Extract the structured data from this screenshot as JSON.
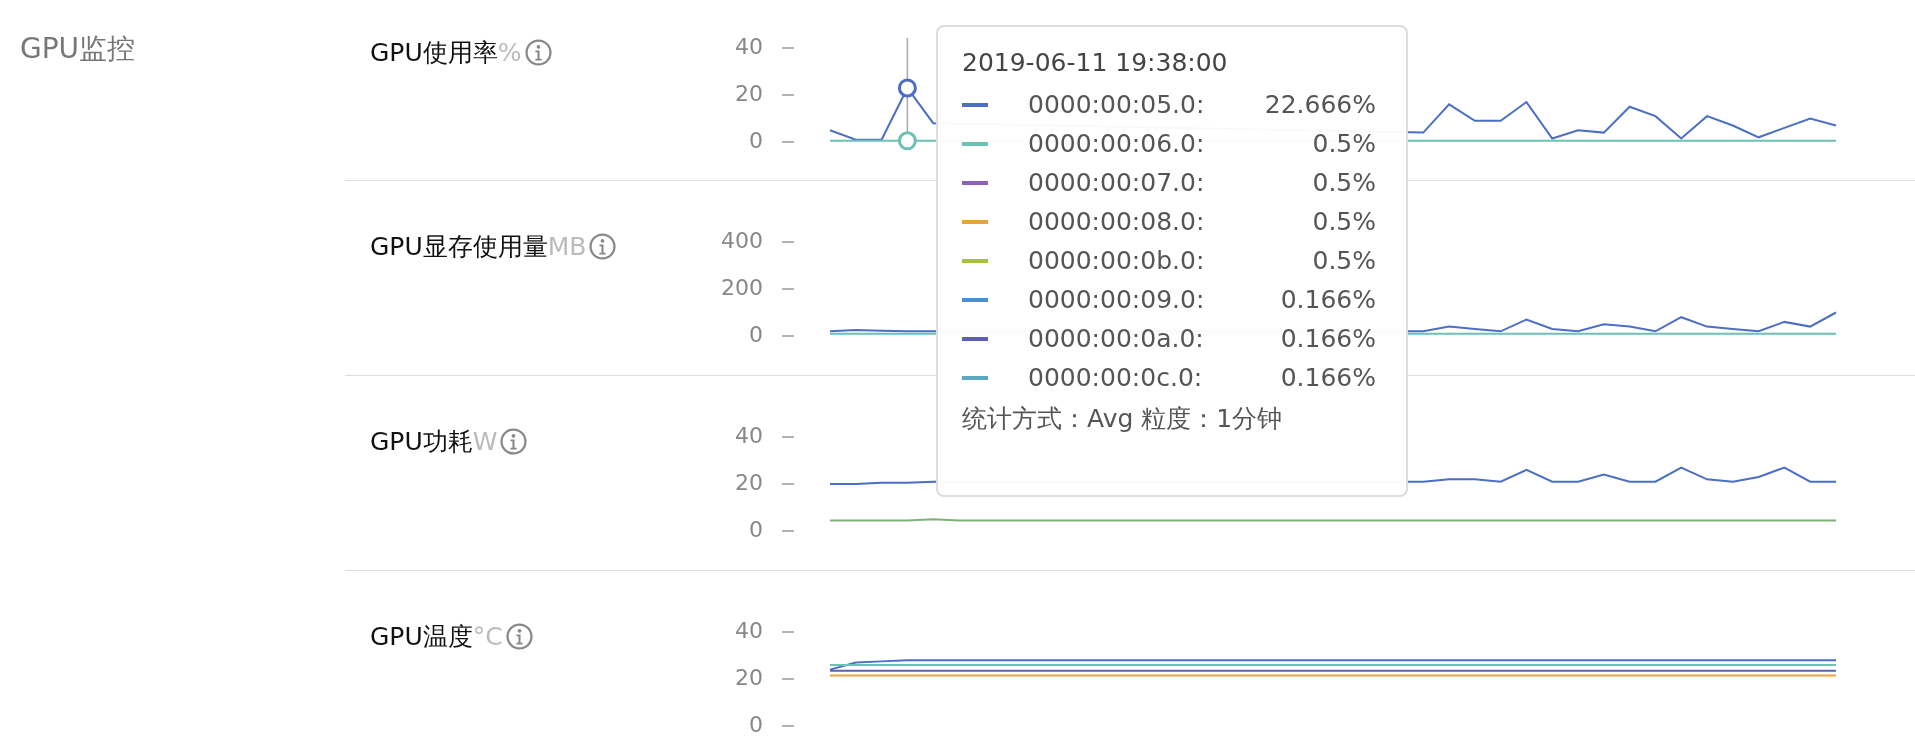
{
  "page_title": "GPU监控",
  "panels": [
    {
      "title": "GPU使用率",
      "unit": "%",
      "chart_data": {
        "type": "line",
        "ylim": [
          0,
          40
        ],
        "yticks": [
          0,
          20,
          40
        ],
        "series": [
          {
            "color": "#4a6fc4",
            "values": [
              5,
              1,
              1,
              23,
              8,
              null,
              null,
              null,
              null,
              null,
              null,
              null,
              null,
              null,
              null,
              null,
              null,
              null,
              null,
              null,
              null,
              null,
              null,
              4,
              16,
              9,
              9,
              17,
              1.5,
              5,
              4,
              15,
              11,
              1.5,
              11,
              7,
              2,
              6,
              10,
              7
            ]
          },
          {
            "color": "#6cc0b4",
            "values": [
              0.5,
              0.5,
              0.5,
              0.5,
              0.5,
              null,
              null,
              null,
              null,
              null,
              null,
              null,
              null,
              null,
              null,
              null,
              null,
              null,
              null,
              null,
              null,
              null,
              null,
              0.5,
              0.5,
              0.5,
              0.5,
              0.5,
              0.5,
              0.5,
              0.5,
              0.5,
              0.5,
              0.5,
              0.5,
              0.5,
              0.5,
              0.5,
              0.5,
              0.5
            ]
          }
        ]
      }
    },
    {
      "title": "GPU显存使用量",
      "unit": "MB",
      "chart_data": {
        "type": "line",
        "ylim": [
          0,
          400
        ],
        "yticks": [
          0,
          200,
          400
        ],
        "series": [
          {
            "color": "#4a6fc4",
            "values": [
              20,
              25,
              22,
              20,
              20,
              null,
              null,
              null,
              null,
              null,
              null,
              null,
              null,
              null,
              null,
              null,
              null,
              null,
              null,
              null,
              null,
              null,
              null,
              20,
              40,
              30,
              20,
              70,
              30,
              20,
              50,
              40,
              20,
              80,
              40,
              30,
              20,
              60,
              40,
              100
            ]
          },
          {
            "color": "#6cc0b4",
            "values": [
              10,
              10,
              10,
              10,
              10,
              null,
              null,
              null,
              null,
              null,
              null,
              null,
              null,
              null,
              null,
              null,
              null,
              null,
              null,
              null,
              null,
              null,
              null,
              10,
              10,
              10,
              10,
              10,
              10,
              10,
              10,
              10,
              10,
              10,
              10,
              10,
              10,
              10,
              10,
              10
            ]
          }
        ]
      }
    },
    {
      "title": "GPU功耗",
      "unit": "W",
      "chart_data": {
        "type": "line",
        "ylim": [
          0,
          40
        ],
        "yticks": [
          0,
          20,
          40
        ],
        "series": [
          {
            "color": "#4a6fc4",
            "values": [
              20,
              20,
              20.5,
              20.5,
              21,
              null,
              null,
              null,
              null,
              null,
              null,
              null,
              null,
              null,
              null,
              null,
              null,
              null,
              null,
              null,
              null,
              null,
              null,
              21,
              22,
              22,
              21,
              26,
              21,
              21,
              24,
              21,
              21,
              27,
              22,
              21,
              23,
              27,
              21,
              21
            ]
          },
          {
            "color": "#7fb07a",
            "values": [
              4.5,
              4.5,
              4.5,
              4.5,
              5,
              4.5,
              4.5,
              4.5,
              4.5,
              4.5,
              4.5,
              4.5,
              4.5,
              4.5,
              4.5,
              4.5,
              4.5,
              4.5,
              4.5,
              4.5,
              4.5,
              4.5,
              4.5,
              4.5,
              4.5,
              4.5,
              4.5,
              4.5,
              4.5,
              4.5,
              4.5,
              4.5,
              4.5,
              4.5,
              4.5,
              4.5,
              4.5,
              4.5,
              4.5,
              4.5
            ]
          }
        ]
      }
    },
    {
      "title": "GPU温度",
      "unit": "°C",
      "chart_data": {
        "type": "line",
        "ylim": [
          0,
          40
        ],
        "yticks": [
          0,
          20,
          40
        ],
        "series": [
          {
            "color": "#4a6fc4",
            "values": [
              24,
              27,
              27.5,
              28,
              28,
              28,
              28,
              28,
              28,
              28,
              28,
              28,
              28,
              28,
              28,
              28,
              28,
              28,
              28,
              28,
              28,
              28,
              28,
              28,
              28,
              28,
              28,
              28,
              28,
              28,
              28,
              28,
              28,
              28,
              28,
              28,
              28,
              28,
              28,
              28
            ]
          },
          {
            "color": "#6cc0b4",
            "values": [
              26,
              26,
              26,
              26,
              26,
              26,
              26,
              26,
              26,
              26,
              26,
              26,
              26,
              26,
              26,
              26,
              26,
              26,
              26,
              26,
              26,
              26,
              26,
              26,
              26,
              26,
              26,
              26,
              26,
              26,
              26,
              26,
              26,
              26,
              26,
              26,
              26,
              26,
              26,
              26
            ]
          },
          {
            "color": "#5b5fb5",
            "values": [
              23.5,
              23.5,
              23.5,
              23.5,
              23.5,
              23.5,
              23.5,
              23.5,
              23.5,
              23.5,
              23.5,
              23.5,
              23.5,
              23.5,
              23.5,
              23.5,
              23.5,
              23.5,
              23.5,
              23.5,
              23.5,
              23.5,
              23.5,
              23.5,
              23.5,
              23.5,
              23.5,
              23.5,
              23.5,
              23.5,
              23.5,
              23.5,
              23.5,
              23.5,
              23.5,
              23.5,
              23.5,
              23.5,
              23.5,
              23.5
            ]
          },
          {
            "color": "#e8a23a",
            "values": [
              21.5,
              21.5,
              21.5,
              21.5,
              21.5,
              21.5,
              21.5,
              21.5,
              21.5,
              21.5,
              21.5,
              21.5,
              21.5,
              21.5,
              21.5,
              21.5,
              21.5,
              21.5,
              21.5,
              21.5,
              21.5,
              21.5,
              21.5,
              21.5,
              21.5,
              21.5,
              21.5,
              21.5,
              21.5,
              21.5,
              21.5,
              21.5,
              21.5,
              21.5,
              21.5,
              21.5,
              21.5,
              21.5,
              21.5,
              21.5
            ]
          }
        ]
      }
    }
  ],
  "tooltip": {
    "time": "2019-06-11 19:38:00",
    "rows": [
      {
        "name": "0000:00:05.0:",
        "value": "22.666%",
        "color": "#4a6fc4"
      },
      {
        "name": "0000:00:06.0:",
        "value": "0.5%",
        "color": "#6cc0b4"
      },
      {
        "name": "0000:00:07.0:",
        "value": "0.5%",
        "color": "#8d5fc0"
      },
      {
        "name": "0000:00:08.0:",
        "value": "0.5%",
        "color": "#e8a23a"
      },
      {
        "name": "0000:00:0b.0:",
        "value": "0.5%",
        "color": "#a2c04a"
      },
      {
        "name": "0000:00:09.0:",
        "value": "0.166%",
        "color": "#4b8fd0"
      },
      {
        "name": "0000:00:0a.0:",
        "value": "0.166%",
        "color": "#5b5fb5"
      },
      {
        "name": "0000:00:0c.0:",
        "value": "0.166%",
        "color": "#5ea7c0"
      }
    ],
    "footer": "统计方式：Avg 粒度：1分钟"
  }
}
